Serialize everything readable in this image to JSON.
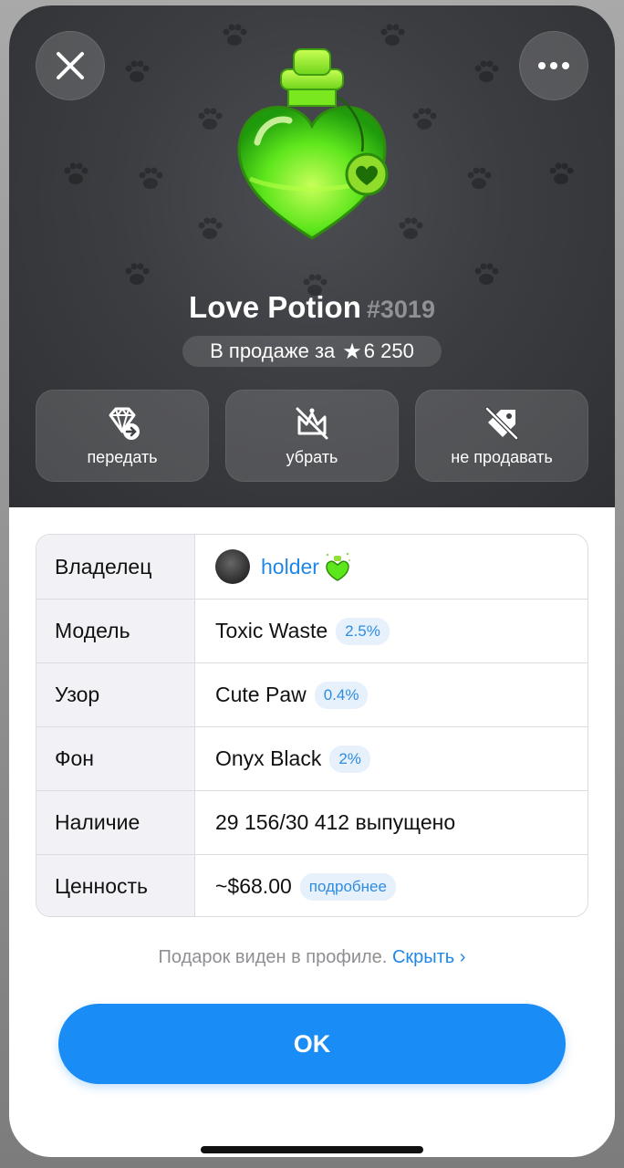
{
  "header": {
    "gift_name": "Love Potion",
    "gift_number": "#3019",
    "sale_prefix": "В продаже за",
    "sale_price": "6 250"
  },
  "actions": [
    {
      "label": "передать",
      "icon": "gem-transfer-icon"
    },
    {
      "label": "убрать",
      "icon": "crown-off-icon"
    },
    {
      "label": "не продавать",
      "icon": "tag-off-icon"
    }
  ],
  "details": {
    "owner": {
      "key": "Владелец",
      "name": "holder"
    },
    "model": {
      "key": "Модель",
      "value": "Toxic Waste",
      "rarity": "2.5%"
    },
    "pattern": {
      "key": "Узор",
      "value": "Cute Paw",
      "rarity": "0.4%"
    },
    "backdrop": {
      "key": "Фон",
      "value": "Onyx Black",
      "rarity": "2%"
    },
    "availability": {
      "key": "Наличие",
      "value": "29 156/30 412 выпущено"
    },
    "value": {
      "key": "Ценность",
      "value": "~$68.00",
      "more": "подробнее"
    }
  },
  "footer": {
    "note": "Подарок виден в профиле.",
    "hide_link": "Скрыть",
    "ok_label": "OK"
  },
  "colors": {
    "accent": "#1a8cf5",
    "potion_green": "#5ee61c",
    "hero_bg": "#3b3d41"
  }
}
